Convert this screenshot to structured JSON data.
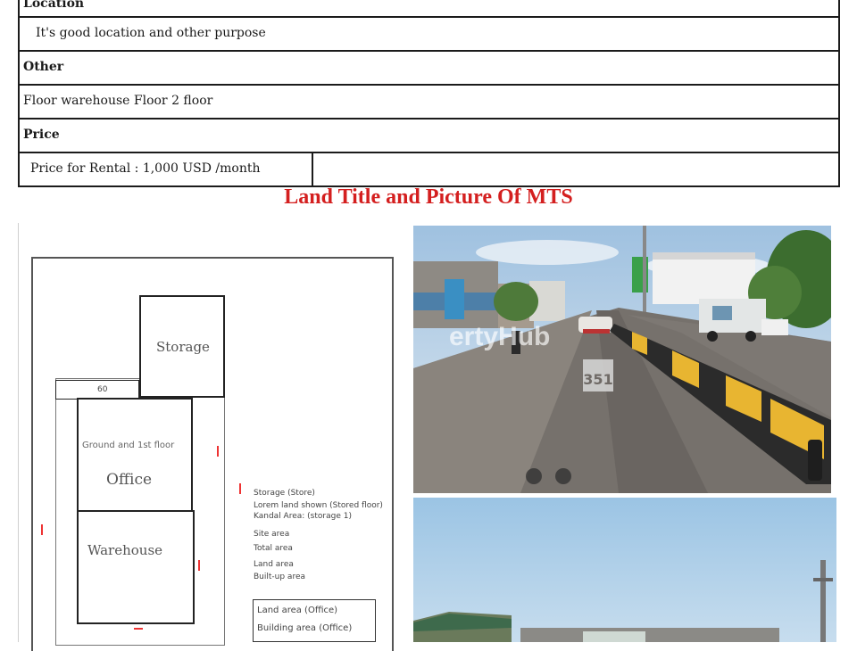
{
  "table": {
    "row_location_header": "Location",
    "row_location_value": "It's good location and other purpose",
    "row_other_header": "Other",
    "row_other_value": "Floor warehouse Floor 2 floor",
    "row_price_header": "Price",
    "row_price_value": "Price for Rental : 1,000 USD /month"
  },
  "section_title": "Land Title and Picture Of MTS",
  "plan": {
    "storage": "Storage",
    "office_top": "Ground and 1st floor",
    "office": "Office",
    "warehouse": "Warehouse",
    "small_label": "60",
    "notes": [
      "Storage (Store)",
      "Lorem land shown (Stored floor)",
      "Kandal Area: (storage 1)",
      "Site area",
      "Total area",
      "Land area",
      "Built-up area"
    ],
    "legend_1": "Land area (Office)",
    "legend_2": "Building area (Office)"
  },
  "photos": {
    "watermark": "ertyHub",
    "road_marking": "351"
  },
  "colors": {
    "title_red": "#d41f1f",
    "sky": "#b7d3ea",
    "road": "#6f6a66",
    "barrier_yellow": "#e8b531"
  }
}
